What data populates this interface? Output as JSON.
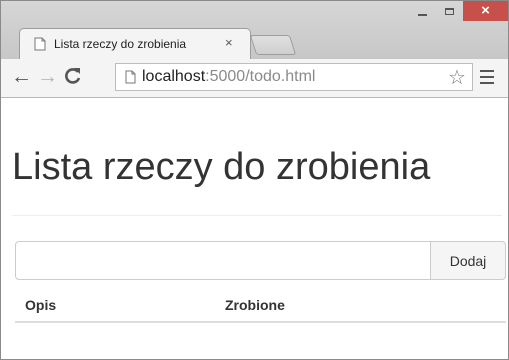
{
  "browser": {
    "tab": {
      "title": "Lista rzeczy do zrobienia",
      "icon": "page-icon",
      "close": "×"
    },
    "window_controls": {
      "minimize": "minimize-icon",
      "maximize": "maximize-icon",
      "close": "×"
    },
    "nav": {
      "back": "←",
      "forward": "→",
      "reload": "C"
    },
    "address": {
      "host": "localhost",
      "rest": ":5000/todo.html"
    },
    "bookmark": "☆"
  },
  "page": {
    "heading": "Lista rzeczy do zrobienia",
    "input": {
      "value": "",
      "placeholder": ""
    },
    "add_button": "Dodaj",
    "table": {
      "headers": [
        "Opis",
        "Zrobione"
      ],
      "rows": []
    }
  },
  "colors": {
    "close_button": "#c7504a",
    "chrome": "#f4f4f4"
  }
}
